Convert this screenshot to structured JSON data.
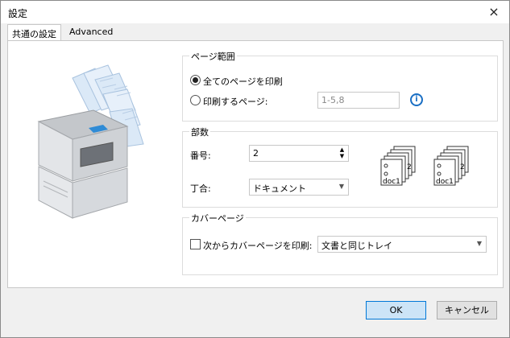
{
  "window": {
    "title": "設定",
    "close_glyph": "×"
  },
  "tabs": [
    {
      "label": "共通の設定"
    },
    {
      "label": "Advanced"
    }
  ],
  "page_range": {
    "label": "ページ範囲",
    "all_pages_label": "全てのページを印刷",
    "pages_label": "印刷するページ:",
    "pages_placeholder": "1-5,8",
    "info_glyph": "i"
  },
  "copies": {
    "label": "部数",
    "number_label": "番号:",
    "number_value": "2",
    "collate_label": "丁合:",
    "collate_value": "ドキュメント",
    "icon_doc_label": "doc1",
    "icon_count_label": "2"
  },
  "cover": {
    "label": "カバーページ",
    "checkbox_label": "次からカバーページを印刷:",
    "select_value": "文書と同じトレイ"
  },
  "buttons": {
    "ok": "OK",
    "cancel": "キャンセル"
  }
}
